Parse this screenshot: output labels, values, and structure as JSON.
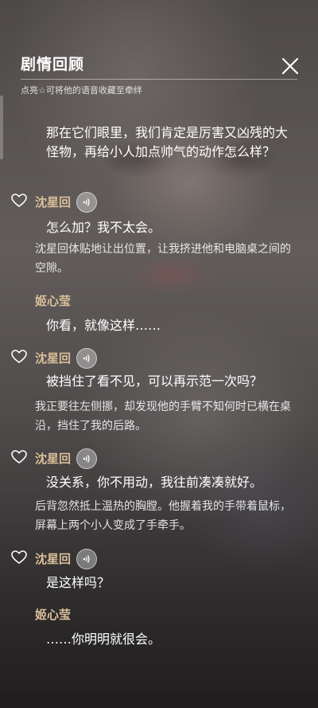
{
  "header": {
    "title": "剧情回顾",
    "hint": "点亮☆可将他的语音收藏至牵绊"
  },
  "entries": [
    {
      "type": "line",
      "speaker": "",
      "text": "那在它们眼里，我们肯定是厉害又凶残的大怪物，再给小人加点帅气的动作怎么样？"
    },
    {
      "type": "line",
      "speaker": "沈星回",
      "text": "怎么加？我不太会。"
    },
    {
      "type": "narration",
      "text": "沈星回体贴地让出位置，让我挤进他和电脑桌之间的空隙。"
    },
    {
      "type": "line",
      "speaker": "姬心莹",
      "text": "你看，就像这样……"
    },
    {
      "type": "line",
      "speaker": "沈星回",
      "text": "被挡住了看不见，可以再示范一次吗？"
    },
    {
      "type": "narration",
      "text": "我正要往左侧挪，却发现他的手臂不知何时已横在桌沿，挡住了我的后路。"
    },
    {
      "type": "line",
      "speaker": "沈星回",
      "text": "没关系，你不用动，我往前凑凑就好。"
    },
    {
      "type": "narration",
      "text": "后背忽然抵上温热的胸膛。他握着我的手带着鼠标，屏幕上两个小人变成了手牵手。"
    },
    {
      "type": "line",
      "speaker": "沈星回",
      "text": "是这样吗？"
    },
    {
      "type": "line",
      "speaker": "姬心莹",
      "text": "……你明明就很会。"
    }
  ],
  "icons": {
    "close": "close-icon",
    "favorite": "heart-outline-icon",
    "voice": "voice-play-icon"
  },
  "colors": {
    "speaker": "#d9bf9a",
    "text": "#ffffff",
    "divider": "#ffffff"
  }
}
